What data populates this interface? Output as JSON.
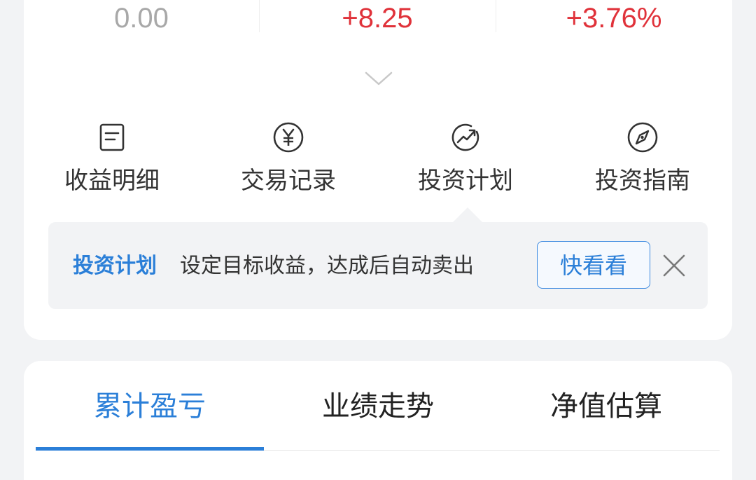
{
  "stats": {
    "values": [
      "0.00",
      "+8.25",
      "+3.76%"
    ],
    "neutral_color": "#a8a8a8",
    "positive_color": "#e0323a"
  },
  "expand_icon": "chevron-down-icon",
  "quick_actions": [
    {
      "label": "收益明细",
      "icon": "document-icon"
    },
    {
      "label": "交易记录",
      "icon": "yen-circle-icon"
    },
    {
      "label": "投资计划",
      "icon": "trend-up-icon"
    },
    {
      "label": "投资指南",
      "icon": "compass-icon"
    }
  ],
  "tip": {
    "title": "投资计划",
    "text": "设定目标收益，达成后自动卖出",
    "button_label": "快看看",
    "close_icon": "close-icon"
  },
  "tabs": [
    {
      "label": "累计盈亏",
      "active": true
    },
    {
      "label": "业绩走势",
      "active": false
    },
    {
      "label": "净值估算",
      "active": false
    }
  ],
  "colors": {
    "accent": "#2b7fd8",
    "background": "#f2f3f5",
    "card": "#ffffff"
  }
}
